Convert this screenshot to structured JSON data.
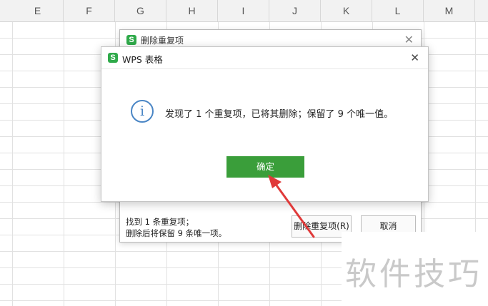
{
  "spreadsheet": {
    "columns": [
      "E",
      "F",
      "G",
      "H",
      "I",
      "J",
      "K",
      "L",
      "M"
    ]
  },
  "background_dialog": {
    "title": "删除重复项",
    "message_line1": "找到 1 条重复项；",
    "message_line2": "删除后将保留 9 条唯一项。",
    "delete_button_label": "删除重复项(R)",
    "cancel_button_label": "取消",
    "close_symbol": "✕",
    "icon_glyph": "S"
  },
  "dialog": {
    "title": "WPS 表格",
    "message": "发现了 1 个重复项，已将其删除；保留了 9 个唯一值。",
    "ok_button_label": "确定",
    "close_symbol": "✕",
    "info_glyph": "i",
    "icon_glyph": "S",
    "button_color": "#3a9e3a",
    "info_color": "#4a86c5"
  },
  "annotation": {
    "arrow_color": "#e03a3a"
  },
  "watermark": {
    "text": "软件技巧"
  }
}
